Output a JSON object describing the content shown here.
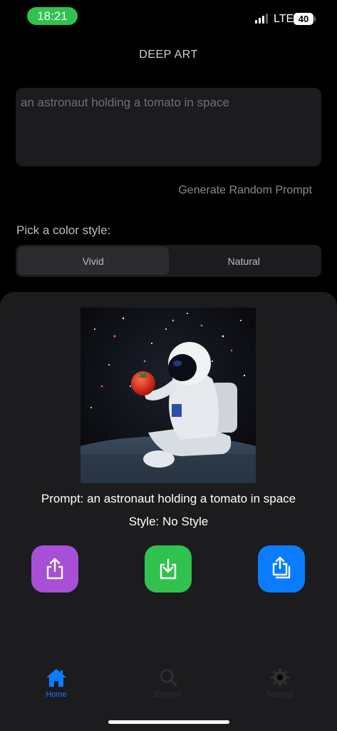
{
  "status_bar": {
    "time": "18:21",
    "network": "LTE",
    "battery": "40"
  },
  "header": {
    "title": "DEEP ART"
  },
  "prompt_input": {
    "value": "an astronaut holding a tomato in space"
  },
  "random_prompt_button": "Generate Random Prompt",
  "color_style": {
    "label": "Pick a color style:",
    "options": [
      "Vivid",
      "Natural"
    ],
    "selected": "Vivid"
  },
  "result": {
    "prompt_line": "Prompt: an astronaut holding a tomato in space",
    "style_line": "Style: No Style",
    "actions": {
      "share_icon": "share-icon",
      "save_icon": "download-icon",
      "share_all_icon": "share-multiple-icon"
    }
  },
  "tabbar": {
    "items": [
      {
        "label": "Home",
        "icon": "house-icon",
        "active": true
      },
      {
        "label": "Explore",
        "icon": "magnifier-icon",
        "active": false
      },
      {
        "label": "Settings",
        "icon": "gear-icon",
        "active": false
      }
    ]
  },
  "colors": {
    "accent": "#0a7cff",
    "share": "#a74fd6",
    "save": "#30c24e",
    "share_all": "#0a7cff"
  }
}
